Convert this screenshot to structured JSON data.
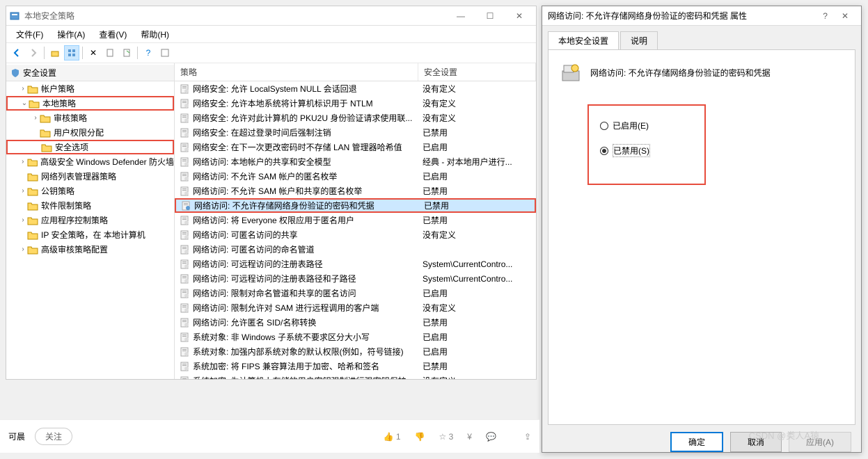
{
  "mainWindow": {
    "title": "本地安全策略",
    "menu": {
      "file": "文件(F)",
      "action": "操作(A)",
      "view": "查看(V)",
      "help": "帮助(H)"
    }
  },
  "tree": {
    "root": "安全设置",
    "items": [
      {
        "label": "帐户策略",
        "expand": ">"
      },
      {
        "label": "本地策略",
        "expand": "v",
        "hl": true
      },
      {
        "label": "审核策略",
        "expand": ">",
        "indent": 2
      },
      {
        "label": "用户权限分配",
        "expand": "",
        "indent": 2
      },
      {
        "label": "安全选项",
        "expand": "",
        "indent": 2,
        "hl": true
      },
      {
        "label": "高级安全 Windows Defender 防火墙",
        "expand": ">"
      },
      {
        "label": "网络列表管理器策略",
        "expand": ""
      },
      {
        "label": "公钥策略",
        "expand": ">"
      },
      {
        "label": "软件限制策略",
        "expand": ""
      },
      {
        "label": "应用程序控制策略",
        "expand": ">"
      },
      {
        "label": "IP 安全策略，在 本地计算机",
        "expand": ""
      },
      {
        "label": "高级审核策略配置",
        "expand": ">"
      }
    ]
  },
  "list": {
    "headers": {
      "policy": "策略",
      "setting": "安全设置"
    },
    "rows": [
      {
        "p": "网络安全: 允许 LocalSystem NULL 会话回退",
        "s": "没有定义"
      },
      {
        "p": "网络安全: 允许本地系统将计算机标识用于 NTLM",
        "s": "没有定义"
      },
      {
        "p": "网络安全: 允许对此计算机的 PKU2U 身份验证请求使用联...",
        "s": "没有定义"
      },
      {
        "p": "网络安全: 在超过登录时间后强制注销",
        "s": "已禁用"
      },
      {
        "p": "网络安全: 在下一次更改密码时不存储 LAN 管理器哈希值",
        "s": "已启用"
      },
      {
        "p": "网络访问: 本地帐户的共享和安全模型",
        "s": "经典 - 对本地用户进行..."
      },
      {
        "p": "网络访问: 不允许 SAM 帐户的匿名枚举",
        "s": "已启用"
      },
      {
        "p": "网络访问: 不允许 SAM 帐户和共享的匿名枚举",
        "s": "已禁用"
      },
      {
        "p": "网络访问: 不允许存储网络身份验证的密码和凭据",
        "s": "已禁用",
        "sel": true
      },
      {
        "p": "网络访问: 将 Everyone 权限应用于匿名用户",
        "s": "已禁用"
      },
      {
        "p": "网络访问: 可匿名访问的共享",
        "s": "没有定义"
      },
      {
        "p": "网络访问: 可匿名访问的命名管道",
        "s": ""
      },
      {
        "p": "网络访问: 可远程访问的注册表路径",
        "s": "System\\CurrentContro..."
      },
      {
        "p": "网络访问: 可远程访问的注册表路径和子路径",
        "s": "System\\CurrentContro..."
      },
      {
        "p": "网络访问: 限制对命名管道和共享的匿名访问",
        "s": "已启用"
      },
      {
        "p": "网络访问: 限制允许对 SAM 进行远程调用的客户端",
        "s": "没有定义"
      },
      {
        "p": "网络访问: 允许匿名 SID/名称转换",
        "s": "已禁用"
      },
      {
        "p": "系统对象: 非 Windows 子系统不要求区分大小写",
        "s": "已启用"
      },
      {
        "p": "系统对象: 加强内部系统对象的默认权限(例如，符号链接)",
        "s": "已启用"
      },
      {
        "p": "系统加密: 将 FIPS 兼容算法用于加密、哈希和签名",
        "s": "已禁用"
      },
      {
        "p": "系统加密: 为计算机上存储的用户密钥强制进行强密钥保护",
        "s": "没有定义"
      }
    ]
  },
  "dialog": {
    "title": "网络访问: 不允许存储网络身份验证的密码和凭据 属性",
    "tabs": {
      "t1": "本地安全设置",
      "t2": "说明"
    },
    "heading": "网络访问: 不允许存储网络身份验证的密码和凭据",
    "opt_enabled": "已启用(E)",
    "opt_disabled": "已禁用(S)",
    "btn_ok": "确定",
    "btn_cancel": "取消",
    "btn_apply": "应用(A)"
  },
  "bottom": {
    "label": "可晨",
    "follow": "关注",
    "like": "1",
    "star": "3"
  },
  "watermark": "CSDN @类人A猿"
}
